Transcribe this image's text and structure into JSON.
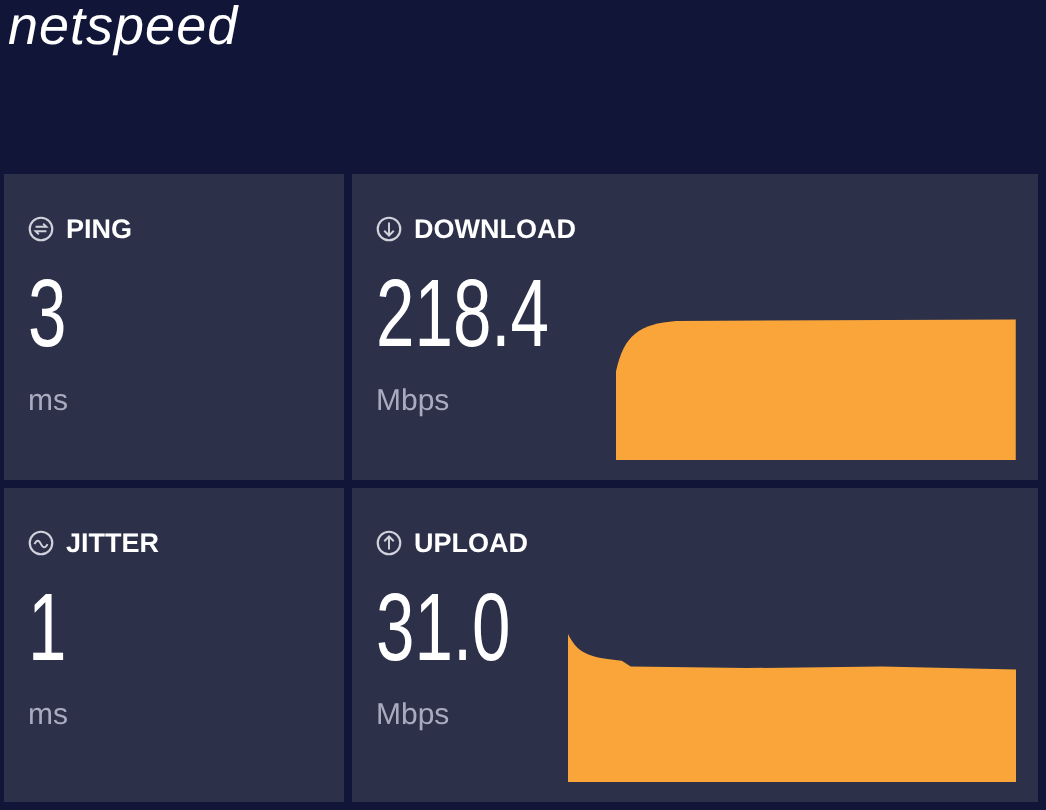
{
  "logo": "netspeed",
  "cards": [
    {
      "label": "PING",
      "kind": "plain",
      "value": "3",
      "unit": "ms"
    },
    {
      "label": "DOWNLOAD",
      "kind": "graph",
      "value": "218.4",
      "unit": "Mbps"
    },
    {
      "label": "JITTER",
      "kind": "plain",
      "value": "1",
      "unit": "ms"
    },
    {
      "label": "UPLOAD",
      "kind": "graph",
      "value": "31.0",
      "unit": "Mbps"
    }
  ]
}
